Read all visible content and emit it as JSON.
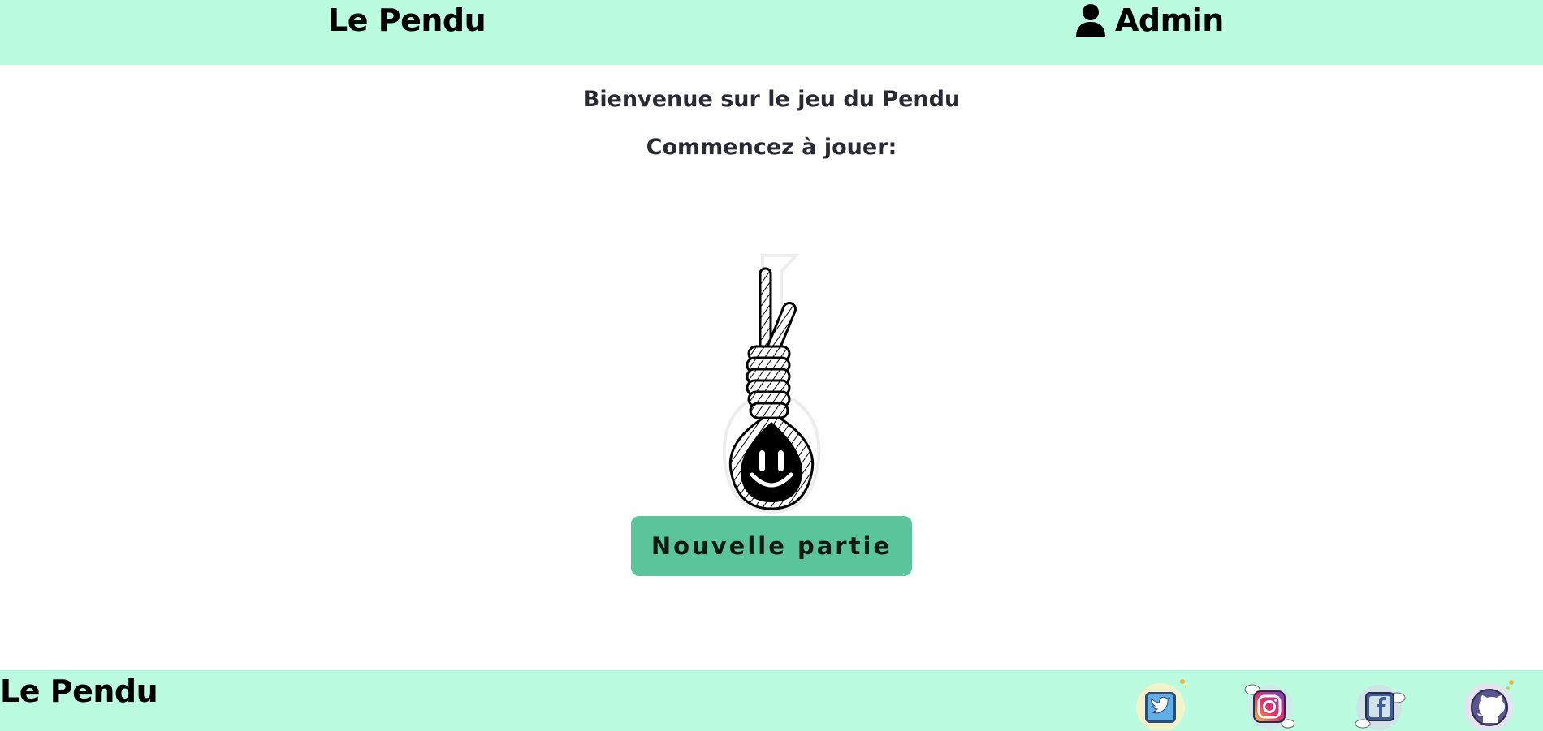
{
  "header": {
    "brand": "Le Pendu",
    "admin_label": "Admin",
    "admin_icon": "user-icon"
  },
  "main": {
    "welcome": "Bienvenue sur le jeu du Pendu",
    "start_prompt": "Commencez à jouer:",
    "illustration": "noose-icon",
    "new_game_label": "Nouvelle partie"
  },
  "footer": {
    "brand": "Le Pendu",
    "socials": [
      "twitter-icon",
      "instagram-icon",
      "facebook-icon",
      "github-icon"
    ]
  },
  "colors": {
    "header_bg": "#bbfbe0",
    "button_bg": "#5ac59b",
    "text_dark": "#2a2a35"
  }
}
